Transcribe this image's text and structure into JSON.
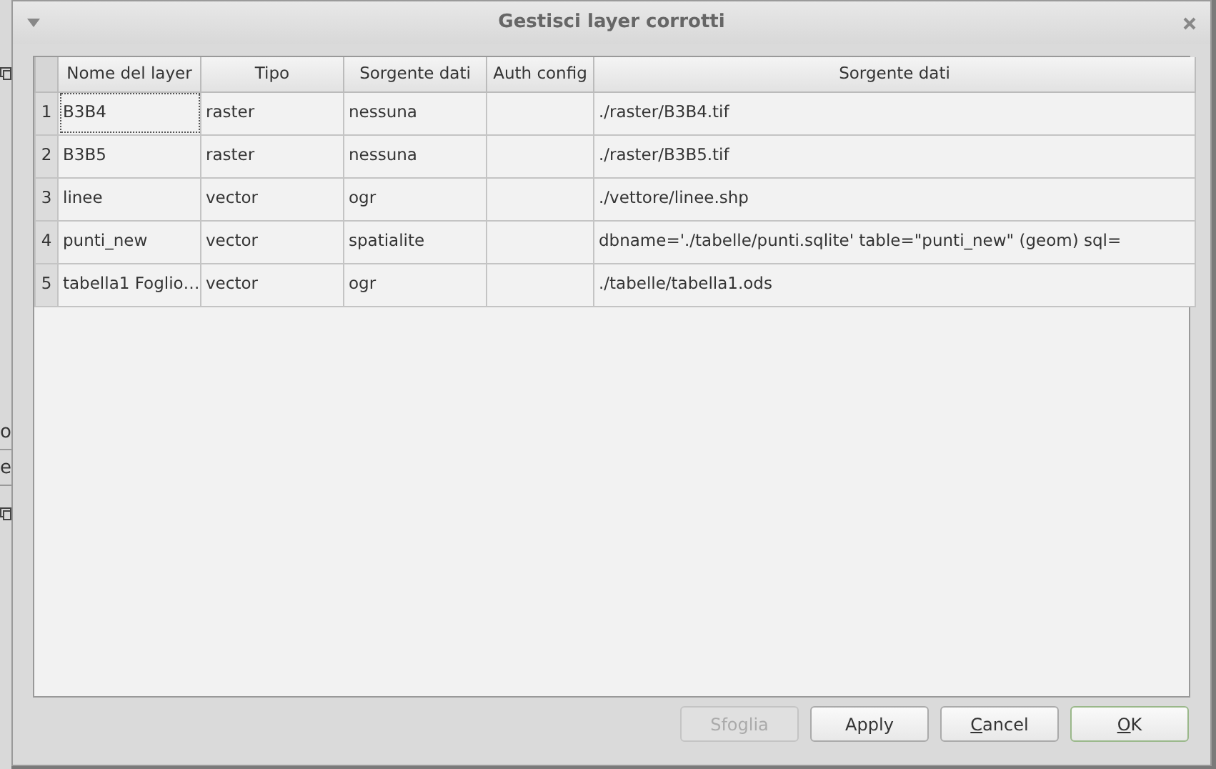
{
  "background_window": {
    "texts": [
      "o",
      "e"
    ]
  },
  "dialog": {
    "title": "Gestisci layer corrotti"
  },
  "table": {
    "columns": [
      "Nome del layer",
      "Tipo",
      "Sorgente dati",
      "Auth config",
      "Sorgente dati"
    ],
    "rows": [
      {
        "number": "1",
        "cells": [
          {
            "text": "B3B4",
            "focused": true
          },
          {
            "text": "raster",
            "focused": false
          },
          {
            "text": "nessuna",
            "focused": false
          },
          {
            "text": "",
            "focused": false
          },
          {
            "text": "./raster/B3B4.tif",
            "focused": false
          }
        ]
      },
      {
        "number": "2",
        "cells": [
          {
            "text": "B3B5",
            "focused": false
          },
          {
            "text": "raster",
            "focused": false
          },
          {
            "text": "nessuna",
            "focused": false
          },
          {
            "text": "",
            "focused": false
          },
          {
            "text": "./raster/B3B5.tif",
            "focused": false
          }
        ]
      },
      {
        "number": "3",
        "cells": [
          {
            "text": "linee",
            "focused": false
          },
          {
            "text": "vector",
            "focused": false
          },
          {
            "text": "ogr",
            "focused": false
          },
          {
            "text": "",
            "focused": false
          },
          {
            "text": "./vettore/linee.shp",
            "focused": false
          }
        ]
      },
      {
        "number": "4",
        "cells": [
          {
            "text": "punti_new",
            "focused": false
          },
          {
            "text": "vector",
            "focused": false
          },
          {
            "text": "spatialite",
            "focused": false
          },
          {
            "text": "",
            "focused": false
          },
          {
            "text": "dbname='./tabelle/punti.sqlite' table=\"punti_new\" (geom) sql=",
            "focused": false
          }
        ]
      },
      {
        "number": "5",
        "cells": [
          {
            "text": "tabella1 Foglio…",
            "focused": false
          },
          {
            "text": "vector",
            "focused": false
          },
          {
            "text": "ogr",
            "focused": false
          },
          {
            "text": "",
            "focused": false
          },
          {
            "text": "./tabelle/tabella1.ods",
            "focused": false
          }
        ]
      }
    ]
  },
  "buttons": [
    {
      "label": "Sfoglia",
      "disabled": true,
      "mnemonic": false,
      "default": false
    },
    {
      "label": "Apply",
      "disabled": false,
      "mnemonic": false,
      "default": false
    },
    {
      "label": "Cancel",
      "disabled": false,
      "mnemonic": true,
      "default": false
    },
    {
      "label": "OK",
      "disabled": false,
      "mnemonic": true,
      "default": true
    }
  ]
}
